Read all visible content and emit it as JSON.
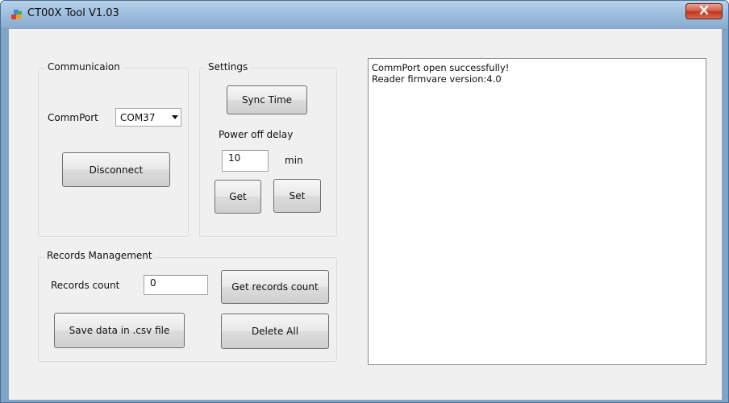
{
  "window": {
    "title": "CT00X Tool V1.03",
    "icons": {
      "app": "colorful-blocks-icon",
      "close": "close-icon"
    }
  },
  "communication": {
    "group_title": "Communicaion",
    "commport_label": "CommPort",
    "commport_selected": "COM37",
    "disconnect_label": "Disconnect"
  },
  "settings": {
    "group_title": "Settings",
    "sync_time_label": "Sync Time",
    "power_off_label": "Power off delay",
    "delay_value": "10",
    "delay_unit": "min",
    "get_label": "Get",
    "set_label": "Set"
  },
  "records": {
    "group_title": "Records Management",
    "count_label": "Records count",
    "count_value": "0",
    "get_count_label": "Get records count",
    "save_csv_label": "Save data in .csv file",
    "delete_all_label": "Delete All"
  },
  "log": {
    "lines": [
      "CommPort open successfully!",
      "Reader firmvare version:4.0"
    ]
  },
  "colors": {
    "titlebar": "#9fc0df",
    "client_bg": "#f0f0f0",
    "close_button": "#c1381f"
  }
}
